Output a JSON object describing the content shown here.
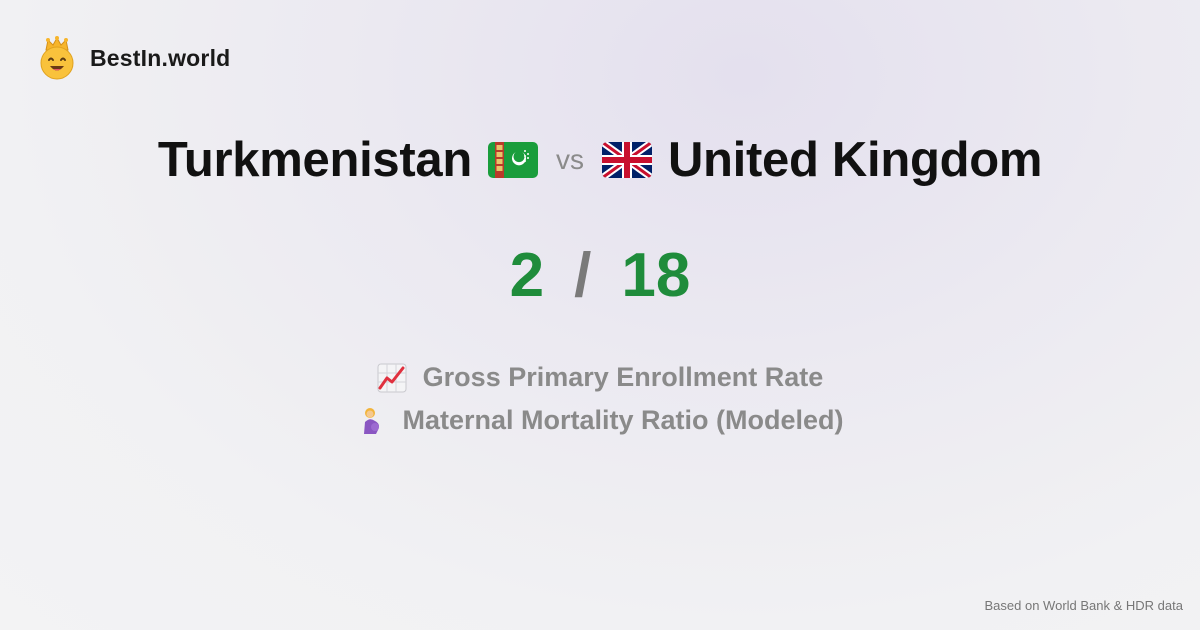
{
  "brand": {
    "name": "BestIn.world",
    "logo_icon": "crowned-smiley-icon"
  },
  "comparison": {
    "country_a": "Turkmenistan",
    "vs_label": "vs",
    "country_b": "United Kingdom",
    "flag_a_icon": "turkmenistan-flag-icon",
    "flag_b_icon": "uk-flag-icon"
  },
  "score": {
    "a": "2",
    "separator": "/",
    "b": "18",
    "color": "#1f8c3b"
  },
  "metrics": [
    {
      "label": "Gross Primary Enrollment Rate",
      "icon": "chart-increasing-icon"
    },
    {
      "label": "Maternal Mortality Ratio (Modeled)",
      "icon": "pregnant-woman-icon"
    }
  ],
  "footer": {
    "note": "Based on World Bank & HDR data"
  }
}
